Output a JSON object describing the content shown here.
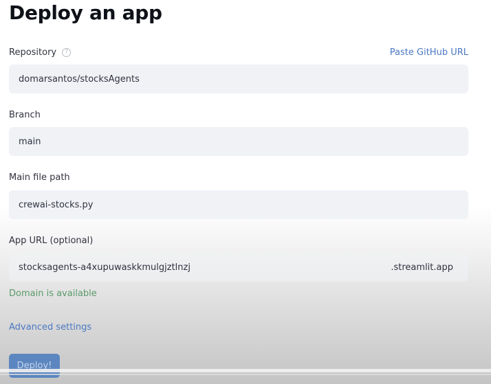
{
  "page": {
    "title": "Deploy an app"
  },
  "repository": {
    "label": "Repository",
    "help_icon": "question-circle-icon",
    "help_glyph": "?",
    "paste_link": "Paste GitHub URL",
    "value": "domarsantos/stocksAgents"
  },
  "branch": {
    "label": "Branch",
    "value": "main"
  },
  "main_file": {
    "label": "Main file path",
    "value": "crewai-stocks.py"
  },
  "app_url": {
    "label": "App URL (optional)",
    "value": "stocksagents-a4xupuwaskkmulgjztlnzj",
    "suffix": ".streamlit.app",
    "status": "Domain is available"
  },
  "advanced_settings": "Advanced settings",
  "deploy_button": "Deploy!"
}
